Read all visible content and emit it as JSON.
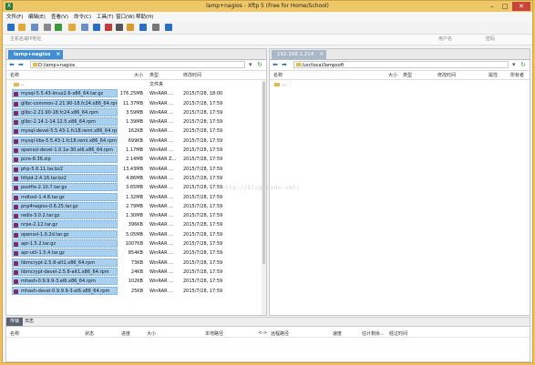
{
  "window": {
    "title": "lamp+nagios - Xftp 5 (Free for Home/School)",
    "min": "–",
    "max": "□",
    "close": "✕"
  },
  "menu": [
    "文件(F)",
    "编辑(E)",
    "查看(V)",
    "命令(C)",
    "工具(T)",
    "窗口(W)",
    "帮助(H)"
  ],
  "toolbar": {
    "icons": [
      "new-session-icon",
      "open-icon",
      "link-icon",
      "properties-icon",
      "refresh-icon",
      "copy-icon",
      "layout-icon",
      "transfer-icon",
      "stop-icon",
      "terminal-icon",
      "lock-icon",
      "font-icon",
      "settings-icon",
      "help-icon"
    ],
    "colors": [
      "#2a6fc2",
      "#e2a93a",
      "#6b8fc2",
      "#888888",
      "#3a9a3a",
      "#e2a93a",
      "#6b8fc2",
      "#2a6fc2",
      "#c23a3a",
      "#555555",
      "#d99a2a",
      "#2a6fc2",
      "#777777",
      "#2a6fc2"
    ]
  },
  "addressbar": {
    "placeholder": "主机名或IP地址",
    "user_placeholder": "用户名",
    "password_placeholder": "密码"
  },
  "left_pane": {
    "tab": "lamp+nagios",
    "path": "D:\\lamp+nagios",
    "columns": {
      "name": "名称",
      "size": "大小",
      "type": "类型",
      "modified": "修改时间"
    },
    "rows": [
      {
        "name": "..",
        "size": "",
        "type": "文件夹",
        "date": "",
        "folder": true,
        "selected": false
      },
      {
        "name": "mysql-5.5.43-linux2.6-x86_64.tar.gz",
        "size": "176.25MB",
        "type": "WinRAR ...",
        "date": "2015/7/28, 18:00",
        "selected": true
      },
      {
        "name": "glibc-common-2.21.90-18.fc24.x86_64.rpm",
        "size": "11.37MB",
        "type": "WinRAR ...",
        "date": "2015/7/28, 17:59",
        "selected": true
      },
      {
        "name": "glibc-2.21.90-18.fc24.x86_64.rpm",
        "size": "3.59MB",
        "type": "WinRAR ...",
        "date": "2015/7/28, 17:59",
        "selected": true
      },
      {
        "name": "glibc-2.14.1-14.12.5.x86_64.rpm",
        "size": "1.39MB",
        "type": "WinRAR ...",
        "date": "2015/7/28, 17:59",
        "selected": true
      },
      {
        "name": "mysql-devel-5.5.43-1.fc18.remi.x86_64.rpm",
        "size": "162KB",
        "type": "WinRAR ...",
        "date": "2015/7/28, 17:59",
        "selected": true
      },
      {
        "name": "mysql-libs-5.5.43-1.fc18.remi.x86_64.rpm",
        "size": "699KB",
        "type": "WinRAR ...",
        "date": "2015/7/28, 17:59",
        "selected": true
      },
      {
        "name": "openssl-devel-1.0.1e-30.el6.x86_64.rpm",
        "size": "1.17MB",
        "type": "WinRAR ...",
        "date": "2015/7/28, 17:59",
        "selected": true
      },
      {
        "name": "pcre-8.36.zip",
        "size": "2.14MB",
        "type": "WinRAR Z...",
        "date": "2015/7/28, 17:59",
        "selected": true
      },
      {
        "name": "php-5.6.11.tar.bz2",
        "size": "13.43MB",
        "type": "WinRAR ...",
        "date": "2015/7/28, 17:59",
        "selected": true
      },
      {
        "name": "httpd-2.4.16.tar.bz2",
        "size": "4.86MB",
        "type": "WinRAR ...",
        "date": "2015/7/28, 17:59",
        "selected": true
      },
      {
        "name": "postfix-2.10.7.tar.gz",
        "size": "3.65MB",
        "type": "WinRAR ...",
        "date": "2015/7/28, 17:59",
        "selected": true
      },
      {
        "name": "mdtool-1.4.8.tar.gz",
        "size": "1.32MB",
        "type": "WinRAR ...",
        "date": "2015/7/28, 17:59",
        "selected": true
      },
      {
        "name": "pnp4nagios-0.6.25.tar.gz",
        "size": "2.79MB",
        "type": "WinRAR ...",
        "date": "2015/7/28, 17:59",
        "selected": true
      },
      {
        "name": "redis-3.0.2.tar.gz",
        "size": "1.30MB",
        "type": "WinRAR ...",
        "date": "2015/7/28, 17:59",
        "selected": true
      },
      {
        "name": "nrpe-2.12.tar.gz",
        "size": "396KB",
        "type": "WinRAR ...",
        "date": "2015/7/28, 17:59",
        "selected": true
      },
      {
        "name": "openssl-1.0.2d.tar.gz",
        "size": "5.05MB",
        "type": "WinRAR ...",
        "date": "2015/7/28, 17:59",
        "selected": true
      },
      {
        "name": "apr-1.5.2.tar.gz",
        "size": "1007KB",
        "type": "WinRAR ...",
        "date": "2015/7/28, 17:59",
        "selected": true
      },
      {
        "name": "apr-util-1.5.4.tar.gz",
        "size": "854KB",
        "type": "WinRAR ...",
        "date": "2015/7/28, 17:59",
        "selected": true
      },
      {
        "name": "libmcrypt-2.5.8-alt1.x86_64.rpm",
        "size": "73KB",
        "type": "WinRAR ...",
        "date": "2015/7/28, 17:59",
        "selected": true
      },
      {
        "name": "libmcrypt-devel-2.5.8-alt1.x86_64.rpm",
        "size": "24KB",
        "type": "WinRAR ...",
        "date": "2015/7/28, 17:59",
        "selected": true
      },
      {
        "name": "mhash-0.9.9.9-3.el6.x86_64.rpm",
        "size": "102KB",
        "type": "WinRAR ...",
        "date": "2015/7/28, 17:59",
        "selected": true
      },
      {
        "name": "mhash-devel-0.9.9.9-3.el6.x86_64.rpm",
        "size": "25KB",
        "type": "WinRAR ...",
        "date": "2015/7/28, 17:59",
        "selected": true
      }
    ]
  },
  "right_pane": {
    "tab": "192.168.1.214",
    "path": "/usr/local/lampsoft",
    "columns": {
      "name": "名称",
      "size": "大小",
      "type": "类型",
      "modified": "修改时间",
      "attr": "属性",
      "owner": "所有者"
    },
    "rows": [
      {
        "name": "..",
        "folder": true
      }
    ]
  },
  "watermark": "http://blog.csdn.net/",
  "bottom": {
    "tabs": [
      "传输",
      "日志"
    ],
    "columns": [
      "名称",
      "状态",
      "进度",
      "大小",
      "本地路径",
      "<->",
      "远程路径",
      "速度",
      "估计剩余...",
      "经过时间"
    ]
  },
  "colors": {
    "accent": "#3f8fd8",
    "title_bar": "#f0c766",
    "selection": "#a9d0ee",
    "file_icon": "#7d2a66"
  }
}
